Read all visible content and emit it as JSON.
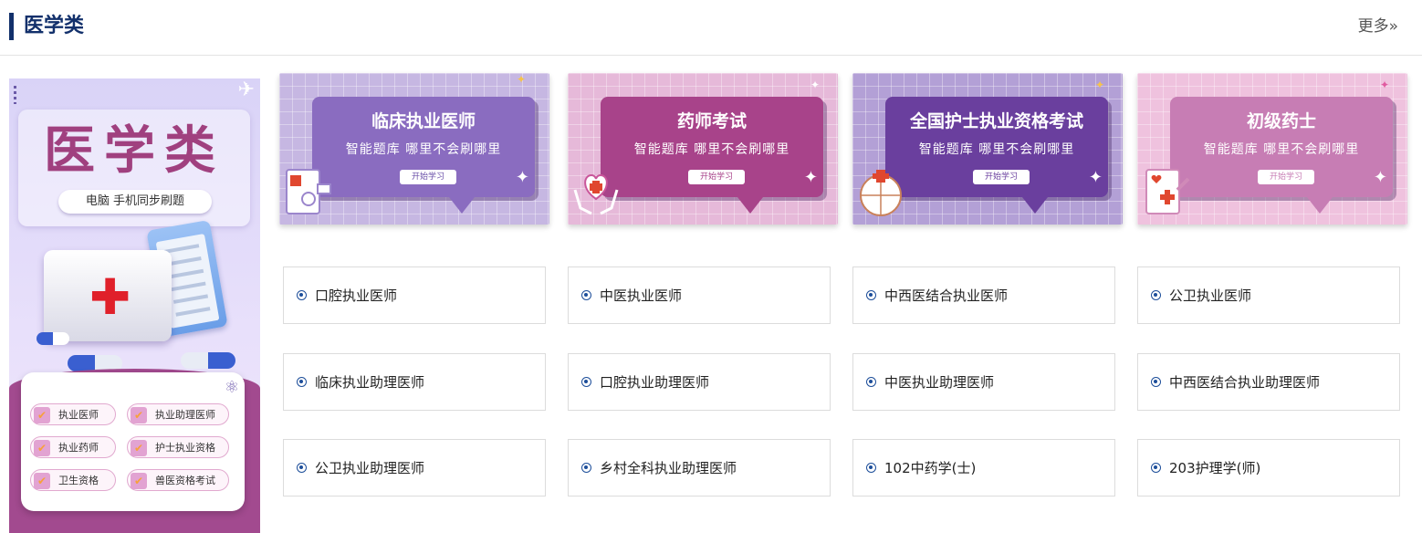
{
  "header": {
    "title": "医学类",
    "more": "更多»"
  },
  "promo": {
    "title": "医学类",
    "subtitle": "电脑 手机同步刷题",
    "tags": [
      "执业医师",
      "执业助理医师",
      "执业药师",
      "护士执业资格",
      "卫生资格",
      "兽医资格考试"
    ]
  },
  "banners": [
    {
      "title": "临床执业医师",
      "subtitle": "智能题库 哪里不会刷哪里",
      "button": "开始学习",
      "bg": "#c6b7e2",
      "bubble": "#8a6cc0",
      "btn_color": "#6a4fa8"
    },
    {
      "title": "药师考试",
      "subtitle": "智能题库 哪里不会刷哪里",
      "button": "开始学习",
      "bg": "#e6b9d9",
      "bubble": "#a8438a",
      "btn_color": "#a8438a"
    },
    {
      "title": "全国护士执业资格考试",
      "subtitle": "智能题库 哪里不会刷哪里",
      "button": "开始学习",
      "bg": "#b3a0d6",
      "bubble": "#6a3f9e",
      "btn_color": "#6a3f9e"
    },
    {
      "title": "初级药士",
      "subtitle": "智能题库 哪里不会刷哪里",
      "button": "开始学习",
      "bg": "#efc2de",
      "bubble": "#c77db4",
      "btn_color": "#c77db4"
    }
  ],
  "links": [
    "口腔执业医师",
    "中医执业医师",
    "中西医结合执业医师",
    "公卫执业医师",
    "临床执业助理医师",
    "口腔执业助理医师",
    "中医执业助理医师",
    "中西医结合执业助理医师",
    "公卫执业助理医师",
    "乡村全科执业助理医师",
    "102中药学(士)",
    "203护理学(师)"
  ],
  "icons": {
    "more": "double-chevron-right-icon",
    "link": "radio-dot-icon",
    "tag": "checkbox-icon"
  }
}
